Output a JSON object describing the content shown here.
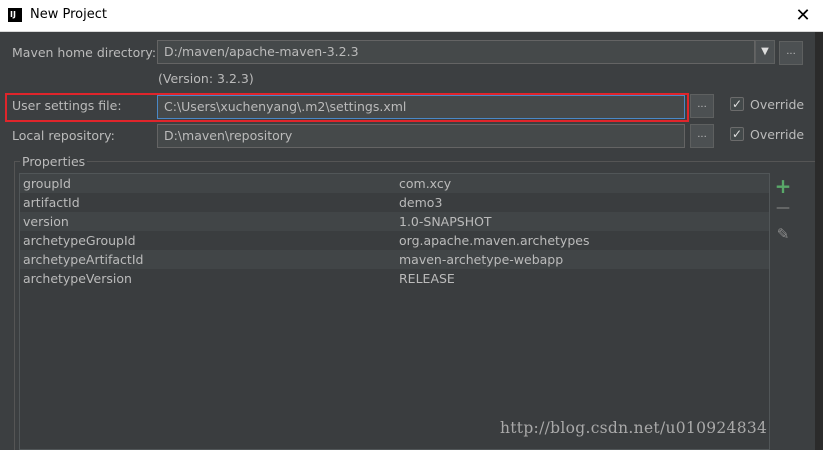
{
  "window": {
    "title": "New Project",
    "close_glyph": "✕",
    "app_icon_text": "IJ"
  },
  "maven_home": {
    "label": "Maven home directory:",
    "value": "D:/maven/apache-maven-3.2.3",
    "version": "(Version: 3.2.3)",
    "arrow_glyph": "▼",
    "dots": "..."
  },
  "user_settings": {
    "label": "User settings file:",
    "value": "C:\\Users\\xuchenyang\\.m2\\settings.xml",
    "dots": "...",
    "override_label": "Override",
    "override_checked": true
  },
  "local_repo": {
    "label": "Local repository:",
    "value": "D:\\maven\\repository",
    "dots": "...",
    "override_label": "Override",
    "override_checked": true
  },
  "properties": {
    "title": "Properties",
    "rows": [
      {
        "key": "groupId",
        "value": "com.xcy"
      },
      {
        "key": "artifactId",
        "value": "demo3"
      },
      {
        "key": "version",
        "value": "1.0-SNAPSHOT"
      },
      {
        "key": "archetypeGroupId",
        "value": "org.apache.maven.archetypes"
      },
      {
        "key": "archetypeArtifactId",
        "value": "maven-archetype-webapp"
      },
      {
        "key": "archetypeVersion",
        "value": "RELEASE"
      }
    ],
    "add_glyph": "+",
    "remove_glyph": "—",
    "edit_glyph": "✎",
    "add_color": "#59a869"
  },
  "check_glyph": "✓",
  "accent_colors": {
    "highlight": "#e0252b",
    "focus": "#4a88c7"
  },
  "watermark": "http://blog.csdn.net/u010924834"
}
